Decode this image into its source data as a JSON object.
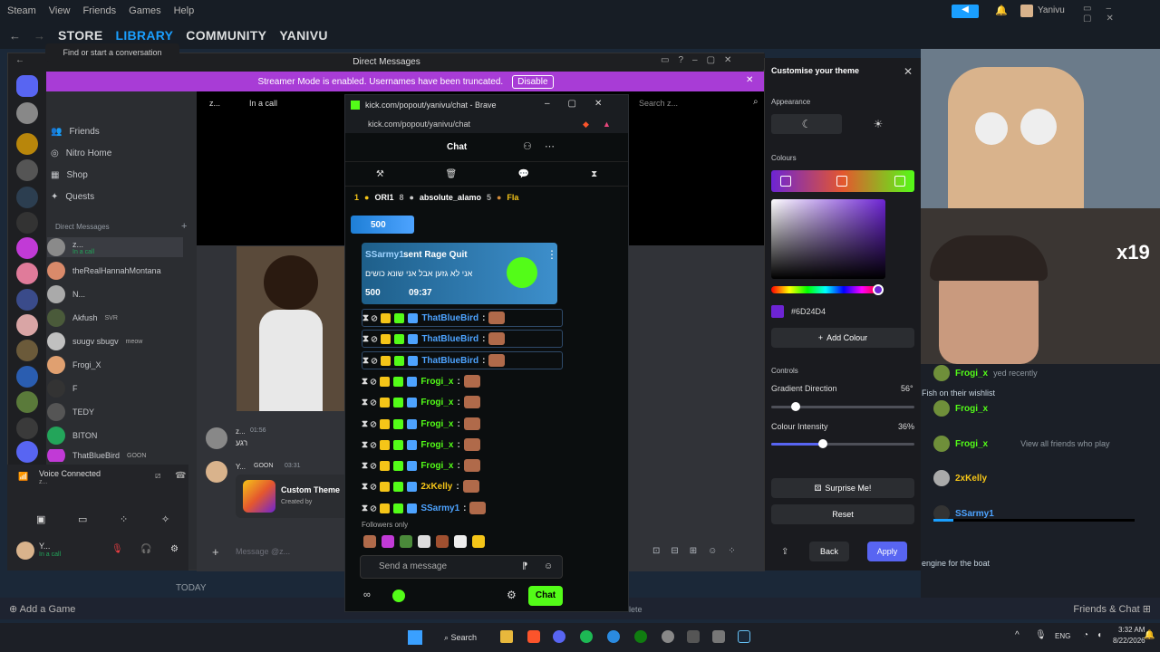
{
  "steam": {
    "menu": [
      "Steam",
      "View",
      "Friends",
      "Games",
      "Help"
    ],
    "tabs": [
      {
        "label": "STORE",
        "active": false
      },
      {
        "label": "LIBRARY",
        "active": true
      },
      {
        "label": "COMMUNITY",
        "active": false
      },
      {
        "label": "YANIVU",
        "active": false
      }
    ],
    "user": "Yanivu",
    "today": "TODAY",
    "add_game": "Add a Game",
    "friends_chat": "Friends & Chat"
  },
  "discord": {
    "window_title": "Direct Messages",
    "streamer_banner": "Streamer Mode is enabled. Usernames have been truncated.",
    "disable_label": "Disable",
    "search_placeholder": "Find or start a conversation",
    "nav": [
      "Friends",
      "Nitro Home",
      "Shop",
      "Quests"
    ],
    "dm_header": "Direct Messages",
    "dms": [
      {
        "name": "z...",
        "sub": "In a call"
      },
      {
        "name": "theRealHannahMontana",
        "sub": ""
      },
      {
        "name": "N...",
        "sub": ""
      },
      {
        "name": "Akfush",
        "sub": "SVR"
      },
      {
        "name": "sʊugv sbugv",
        "sub": "meow"
      },
      {
        "name": "Frogi_X",
        "sub": ""
      },
      {
        "name": "F",
        "sub": ""
      },
      {
        "name": "TEDY",
        "sub": ""
      },
      {
        "name": "BITON",
        "sub": ""
      },
      {
        "name": "ThatBlueBird",
        "sub": "GOON"
      }
    ],
    "call_header_name": "z...",
    "call_status": "In a call",
    "voice_connected": "Voice Connected",
    "voice_sub": "z...",
    "me_name": "Y...",
    "me_status": "In a call",
    "messages": [
      {
        "name": "z...",
        "time": "01:56",
        "text": "רגע"
      },
      {
        "name": "Y...",
        "tag": "GOON",
        "time": "03:31",
        "text": ""
      }
    ],
    "custom_theme_title": "Custom Theme",
    "custom_theme_sub": "Created by",
    "message_placeholder": "Message @z...",
    "search_right": "Search z..."
  },
  "kick": {
    "window_title": "kick.com/popout/yanivu/chat - Brave",
    "url": "kick.com/popout/yanivu/chat",
    "chat_title": "Chat",
    "leaderboard": [
      {
        "rank": "1",
        "name": "ORI1",
        "score": "8"
      },
      {
        "name": "absolute_alamo",
        "score": "5"
      },
      {
        "name": "Fla",
        "score": ""
      }
    ],
    "pinned_amount": "500",
    "rage_quit_user": "SSarmy1",
    "rage_quit_action": "sent Rage Quit",
    "rage_quit_text": "אני לא גזען אבל אני שונא כושים",
    "rage_quit_amount": "500",
    "rage_quit_time": "09:37",
    "messages": [
      {
        "user": "ThatBlueBird",
        "color": "#4da3ff",
        "highlight": true
      },
      {
        "user": "ThatBlueBird",
        "color": "#4da3ff",
        "highlight": true
      },
      {
        "user": "ThatBlueBird",
        "color": "#4da3ff",
        "highlight": true
      },
      {
        "user": "Frogi_x",
        "color": "#53fc18",
        "highlight": false
      },
      {
        "user": "Frogi_x",
        "color": "#53fc18",
        "highlight": false
      },
      {
        "user": "Frogi_x",
        "color": "#53fc18",
        "highlight": false
      },
      {
        "user": "Frogi_x",
        "color": "#53fc18",
        "highlight": false
      },
      {
        "user": "Frogi_x",
        "color": "#53fc18",
        "highlight": false
      },
      {
        "user": "2xKelly",
        "color": "#f5c518",
        "highlight": false
      },
      {
        "user": "SSarmy1",
        "color": "#4da3ff",
        "highlight": false
      }
    ],
    "followers_only": "Followers only",
    "send_placeholder": "Send a message",
    "chat_button": "Chat",
    "accent": "#53fc18"
  },
  "theme": {
    "title": "Customise your theme",
    "appearance": "Appearance",
    "colours": "Colours",
    "hex": "#6D24D4",
    "add_colour": "Add Colour",
    "controls": "Controls",
    "gradient_direction": "Gradient Direction",
    "gradient_value": "56°",
    "gradient_fraction": 0.17,
    "intensity": "Colour Intensity",
    "intensity_value": "36%",
    "intensity_fraction": 0.36,
    "surprise": "Surprise Me!",
    "reset": "Reset",
    "back": "Back",
    "apply": "Apply",
    "accent": "#5865f2"
  },
  "friends": {
    "rows": [
      {
        "name": "Frogi_x",
        "sub": "yed recently"
      },
      {
        "name": "Frogi_x",
        "sub": ""
      },
      {
        "name": "Frogi_x",
        "sub": "View all friends who play"
      },
      {
        "name": "2xKelly",
        "sub": ""
      },
      {
        "name": "SSarmy1",
        "sub": ""
      }
    ],
    "wishlist": "Fish on their wishlist",
    "engine": "engine for the boat",
    "overlay_text": "x19",
    "delete_text": "lete"
  },
  "taskbar": {
    "search": "Search",
    "lang": "ENG",
    "time": "3:32 AM",
    "date": "8/22/2026"
  }
}
